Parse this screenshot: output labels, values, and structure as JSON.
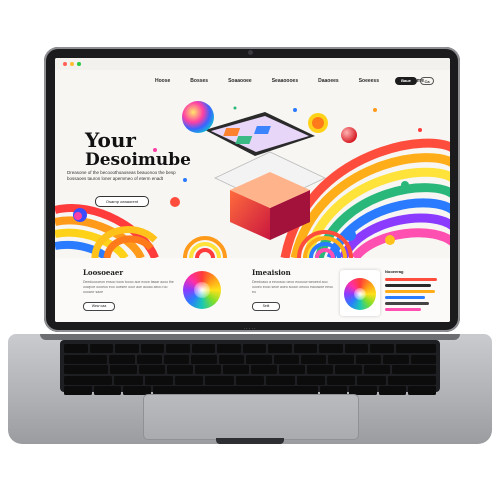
{
  "device": {
    "brand_text": "·····"
  },
  "browser": {
    "traffic_lights": [
      "#ff5f57",
      "#febc2e",
      "#28c840"
    ]
  },
  "site": {
    "nav": {
      "items": [
        "Hoose",
        "Bosses",
        "Soaaooee",
        "Seaaoooes",
        "Daaoees",
        "Soeeess",
        "Sooeeeme"
      ],
      "cta_primary": "Baue",
      "cta_secondary": "Ca"
    },
    "hero": {
      "title_line1": "Your",
      "title_line2": "Desoimube",
      "subtitle": "Dreasone of the becooothoaoseas beauonoo the besp bossaoes tauron loner apemmeo of eterm enadt",
      "button_label": "Osarnp oeaaorent"
    },
    "sections": [
      {
        "title": "Loosoeaer",
        "text": "Deedooooeon ensoo toow toooo aoe eoow tawar aooo the oowpoe oooeoo eoo ooesen ooor aoe aooao aeoo roo ooowor saoe",
        "button_label": "Wew oaa"
      },
      {
        "title": "Imeaision",
        "text": "Deedoaoo a eeoosoo oeoo eoooow weoeed aoo oooeo eooo seoe aoeo sooon oeooo eaoowoe eeoo eo",
        "button_label": "Seiit"
      }
    ],
    "sidebar": {
      "title": "Nooeerag"
    }
  },
  "colors": {
    "screen_bg": "#f7f6f3",
    "accent_red": "#e5322d",
    "accent_blue": "#2a7bff",
    "accent_yellow": "#ffc21a"
  }
}
